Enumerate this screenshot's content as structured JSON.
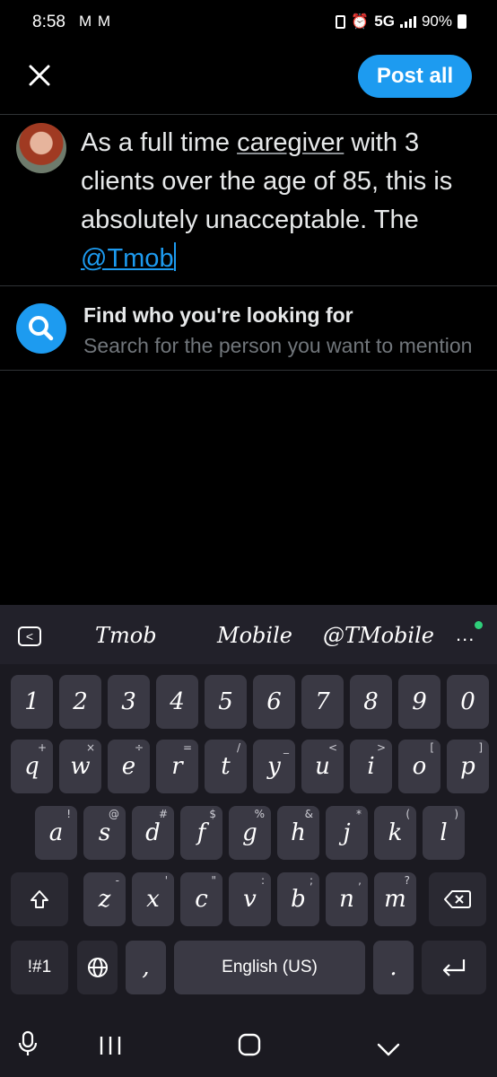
{
  "status_bar": {
    "time": "8:58",
    "left_icons": "M M",
    "network": "5G",
    "battery": "90%"
  },
  "header": {
    "close_icon": "close-icon",
    "post_all_label": "Post all"
  },
  "composer": {
    "text_before": "As a full time ",
    "underlined_word": "caregiver",
    "text_after": " with 3 clients over the age of 85, this is absolutely unacceptable.  The ",
    "mention": "@Tmob"
  },
  "suggestion": {
    "icon": "search-icon",
    "title": "Find who you're looking for",
    "subtitle": "Search for the person you want to mention"
  },
  "keyboard": {
    "predictions": [
      "Tmob",
      "Mobile",
      "@TMobile"
    ],
    "more": "...",
    "number_row": [
      "1",
      "2",
      "3",
      "4",
      "5",
      "6",
      "7",
      "8",
      "9",
      "0"
    ],
    "row1": [
      {
        "k": "q",
        "s": "+"
      },
      {
        "k": "w",
        "s": "×"
      },
      {
        "k": "e",
        "s": "÷"
      },
      {
        "k": "r",
        "s": "="
      },
      {
        "k": "t",
        "s": "/"
      },
      {
        "k": "y",
        "s": "_"
      },
      {
        "k": "u",
        "s": "<"
      },
      {
        "k": "i",
        "s": ">"
      },
      {
        "k": "o",
        "s": "["
      },
      {
        "k": "p",
        "s": "]"
      }
    ],
    "row2": [
      {
        "k": "a",
        "s": "!"
      },
      {
        "k": "s",
        "s": "@"
      },
      {
        "k": "d",
        "s": "#"
      },
      {
        "k": "f",
        "s": "$"
      },
      {
        "k": "g",
        "s": "%"
      },
      {
        "k": "h",
        "s": "&"
      },
      {
        "k": "j",
        "s": "*"
      },
      {
        "k": "k",
        "s": "("
      },
      {
        "k": "l",
        "s": ")"
      }
    ],
    "row3": [
      {
        "k": "z",
        "s": "-"
      },
      {
        "k": "x",
        "s": "'"
      },
      {
        "k": "c",
        "s": "\""
      },
      {
        "k": "v",
        "s": ":"
      },
      {
        "k": "b",
        "s": ";"
      },
      {
        "k": "n",
        "s": ","
      },
      {
        "k": "m",
        "s": "?"
      }
    ],
    "symbols_label": "!#1",
    "comma": ",",
    "space_label": "English (US)",
    "period": ".",
    "shift_icon": "shift-icon",
    "backspace_icon": "backspace-icon",
    "globe_icon": "globe-icon",
    "enter_icon": "enter-icon"
  },
  "nav_bar": {
    "mic": "mic-icon",
    "recents": "recents-icon",
    "home": "home-icon",
    "back": "back-chevron-icon"
  },
  "colors": {
    "accent": "#1d9bf0",
    "background": "#000000",
    "keyboard_bg": "#1b1a21",
    "key_bg": "#3a3944"
  }
}
